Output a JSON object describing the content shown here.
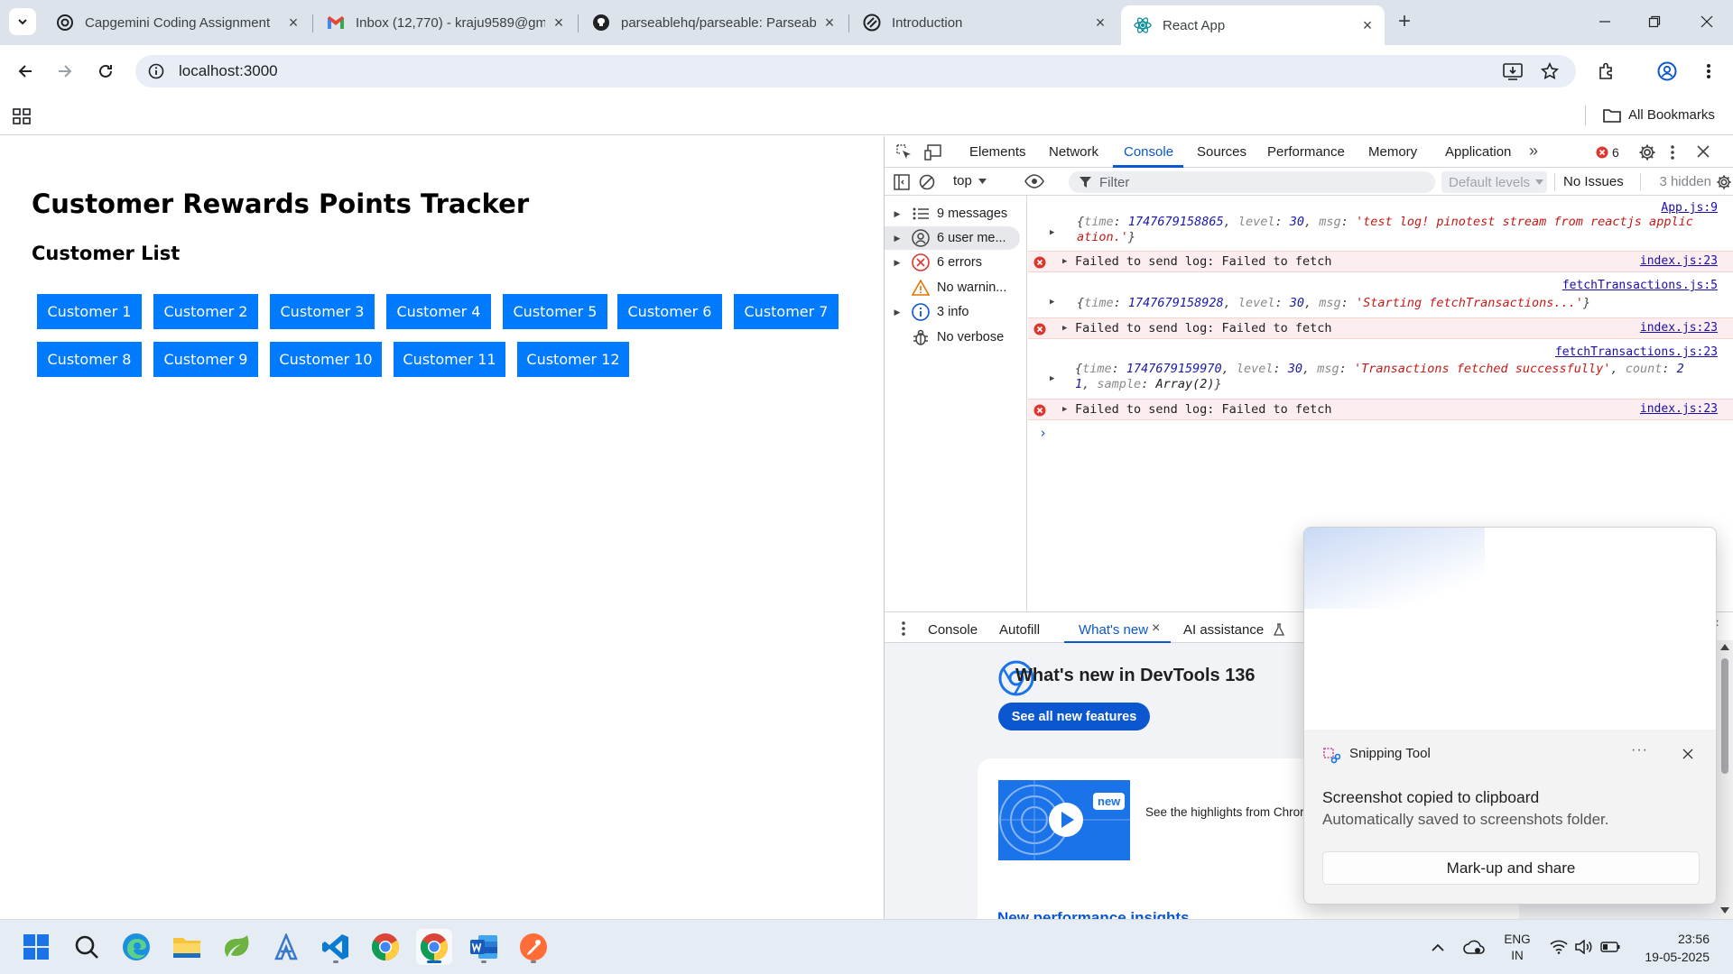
{
  "browser": {
    "tabs": [
      {
        "title": "Capgemini Coding Assignment",
        "icon": "openai-icon"
      },
      {
        "title": "Inbox (12,770) - kraju9589@gm",
        "icon": "gmail-icon"
      },
      {
        "title": "parseablehq/parseable: Parseab",
        "icon": "github-icon"
      },
      {
        "title": "Introduction",
        "icon": "stripes-icon"
      },
      {
        "title": "React App",
        "icon": "react-icon",
        "active": true
      }
    ],
    "url": "localhost:3000",
    "bookmarks_label": "All Bookmarks"
  },
  "page": {
    "title": "Customer Rewards Points Tracker",
    "subtitle": "Customer List",
    "customers": [
      "Customer 1",
      "Customer 2",
      "Customer 3",
      "Customer 4",
      "Customer 5",
      "Customer 6",
      "Customer 7",
      "Customer 8",
      "Customer 9",
      "Customer 10",
      "Customer 11",
      "Customer 12"
    ],
    "button_color": "#007bff"
  },
  "devtools": {
    "tabs": [
      "Elements",
      "Network",
      "Console",
      "Sources",
      "Performance",
      "Memory",
      "Application"
    ],
    "active_tab": "Console",
    "error_count": "6",
    "context": "top",
    "filter_placeholder": "Filter",
    "levels": "Default levels",
    "issues": "No Issues",
    "hidden": "3 hidden",
    "sidebar": [
      {
        "label": "9 messages",
        "icon": "list-icon"
      },
      {
        "label": "6 user me...",
        "icon": "user-icon"
      },
      {
        "label": "6 errors",
        "icon": "error-icon"
      },
      {
        "label": "No warnin...",
        "icon": "warning-icon"
      },
      {
        "label": "3 info",
        "icon": "info-icon"
      },
      {
        "label": "No verbose",
        "icon": "bug-icon"
      }
    ],
    "console": {
      "log1": {
        "src": "App.js:9",
        "time": "1747679158865",
        "level": "30",
        "msg_a": "'test log! pinotest stream from reactjs applic",
        "msg_b": "ation.'"
      },
      "err1": {
        "text": "Failed to send log: Failed to fetch",
        "src": "index.js:23"
      },
      "log2": {
        "src": "fetchTransactions.js:5",
        "time": "1747679158928",
        "level": "30",
        "msg": "'Starting fetchTransactions...'"
      },
      "err2": {
        "text": "Failed to send log: Failed to fetch",
        "src": "index.js:23"
      },
      "log3": {
        "src": "fetchTransactions.js:23",
        "time": "1747679159970",
        "level": "30",
        "msg": "'Transactions fetched successfully'",
        "count_a": "2",
        "count_b": "1",
        "sample": "Array(2)"
      },
      "err3": {
        "text": "Failed to send log: Failed to fetch",
        "src": "index.js:23"
      }
    },
    "drawer_tabs": [
      "Console",
      "Autofill",
      "What's new",
      "AI assistance"
    ],
    "drawer_active": "What's new",
    "whats_new": {
      "title": "What's new in DevTools 136",
      "button": "See all new features",
      "badge": "new",
      "highlights": "See the highlights from Chror",
      "perf_heading": "New performance insights"
    }
  },
  "snipping": {
    "app": "Snipping Tool",
    "title": "Screenshot copied to clipboard",
    "subtitle": "Automatically saved to screenshots folder.",
    "button": "Mark-up and share",
    "more": "···"
  },
  "taskbar": {
    "apps": [
      "start-icon",
      "search-icon",
      "edge-icon",
      "file-explorer-icon",
      "spring-icon",
      "azure-icon",
      "vscode-icon",
      "chrome-icon",
      "chrome-active-icon",
      "word-icon",
      "postman-icon"
    ],
    "lang_1": "ENG",
    "lang_2": "IN",
    "time": "23:56",
    "date": "19-05-2025"
  }
}
